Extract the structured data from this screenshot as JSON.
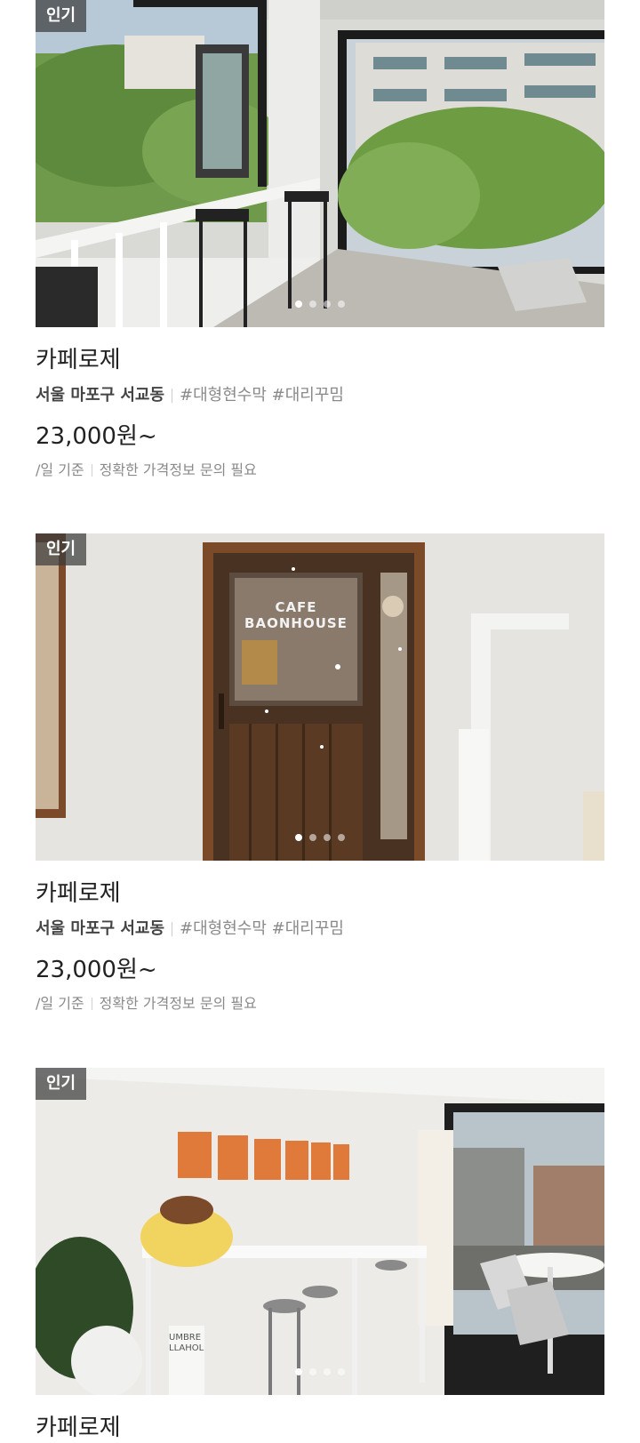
{
  "listings": [
    {
      "badge": "인기",
      "title": "카페로제",
      "location": "서울 마포구 서교동",
      "tags": "#대형현수막 #대리꾸밈",
      "price": "23,000원~",
      "unit": "/일 기준",
      "note": "정확한 가격정보 문의 필요",
      "carousel": {
        "total": 4,
        "active": 1
      }
    },
    {
      "badge": "인기",
      "title": "카페로제",
      "location": "서울 마포구 서교동",
      "tags": "#대형현수막 #대리꾸밈",
      "price": "23,000원~",
      "unit": "/일 기준",
      "note": "정확한 가격정보 문의 필요",
      "door_sign": "CAFE BAONHOUSE",
      "carousel": {
        "total": 4,
        "active": 1
      }
    },
    {
      "badge": "인기",
      "title": "카페로제",
      "umbrella_sign": "UMBRELLAHOL",
      "carousel": {
        "total": 4,
        "active": 1
      }
    }
  ],
  "colors": {
    "text_primary": "#222222",
    "text_secondary": "#8a8a8a",
    "badge_bg": "#3c3c3c"
  }
}
